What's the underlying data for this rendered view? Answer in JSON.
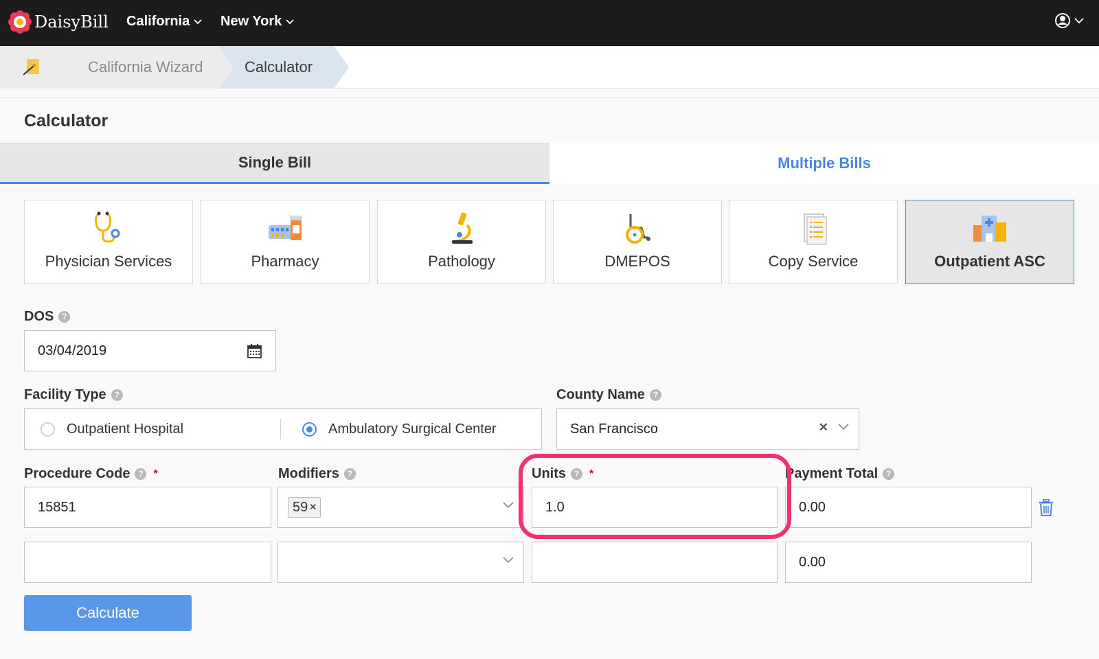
{
  "app": {
    "brand": "DaisyBill",
    "nav": [
      {
        "label": "California"
      },
      {
        "label": "New York"
      }
    ]
  },
  "breadcrumb": {
    "items": [
      "California Wizard",
      "Calculator"
    ]
  },
  "page": {
    "title": "Calculator"
  },
  "tabs": [
    {
      "label": "Single Bill",
      "active": true
    },
    {
      "label": "Multiple Bills",
      "active": false
    }
  ],
  "services": [
    {
      "label": "Physician Services",
      "icon": "stethoscope-icon",
      "selected": false
    },
    {
      "label": "Pharmacy",
      "icon": "pharmacy-icon",
      "selected": false
    },
    {
      "label": "Pathology",
      "icon": "microscope-icon",
      "selected": false
    },
    {
      "label": "DMEPOS",
      "icon": "wheelchair-icon",
      "selected": false
    },
    {
      "label": "Copy Service",
      "icon": "document-icon",
      "selected": false
    },
    {
      "label": "Outpatient ASC",
      "icon": "hospital-icon",
      "selected": true
    }
  ],
  "form": {
    "dos": {
      "label": "DOS",
      "value": "03/04/2019"
    },
    "facility_type": {
      "label": "Facility Type",
      "options": [
        "Outpatient Hospital",
        "Ambulatory Surgical Center"
      ],
      "selected": "Ambulatory Surgical Center"
    },
    "county": {
      "label": "County Name",
      "value": "San Francisco"
    },
    "columns": {
      "procedure_code": "Procedure Code",
      "modifiers": "Modifiers",
      "units": "Units",
      "payment_total": "Payment Total",
      "required_mark": "*"
    },
    "rows": [
      {
        "procedure_code": "15851",
        "modifier_tag": "59",
        "units": "1.0",
        "payment_total": "0.00"
      },
      {
        "procedure_code": "",
        "modifier_tag": "",
        "units": "",
        "payment_total": "0.00"
      }
    ],
    "calculate_label": "Calculate"
  },
  "colors": {
    "accent": "#4a86e0",
    "button": "#5b97e8",
    "highlight": "#f0306f",
    "topbar": "#1c1c1c"
  }
}
